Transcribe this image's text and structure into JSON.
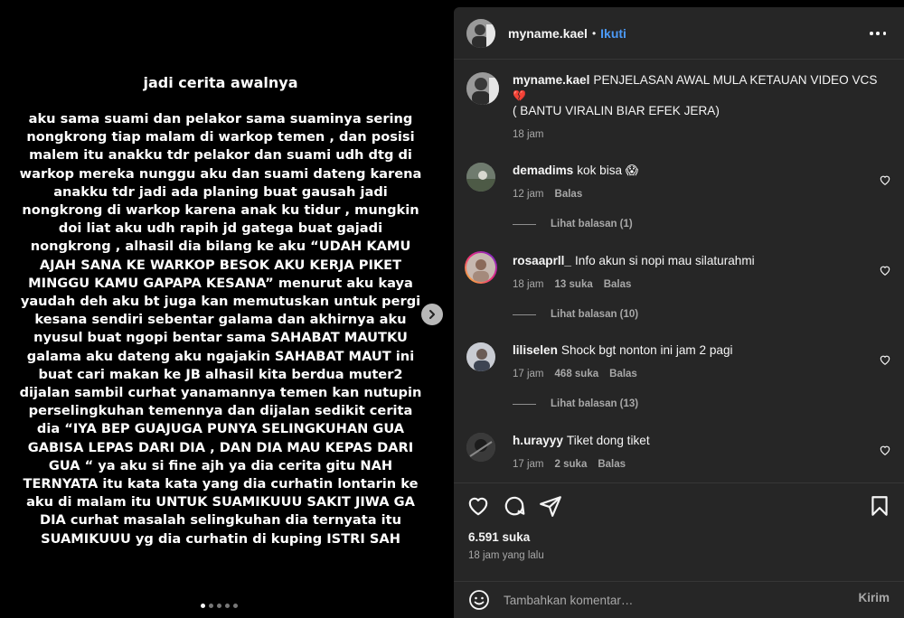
{
  "media": {
    "title": "jadi cerita awalnya",
    "body": "aku sama suami dan pelakor sama suaminya sering\nnongkrong tiap malam di warkop temen , dan posisi\nmalem itu anakku tdr pelakor dan suami udh dtg di\nwarkop mereka nunggu aku dan suami dateng karena\nanakku tdr jadi ada planing buat gausah jadi\nnongkrong di warkop karena anak ku tidur , mungkin\ndoi liat aku udh rapih jd gatega buat gajadi\nnongkrong , alhasil dia bilang ke aku “UDAH KAMU\nAJAH SANA KE WARKOP BESOK AKU KERJA PIKET\nMINGGU KAMU GAPAPA KESANA” menurut aku kaya\nyaudah deh aku bt juga kan memutuskan untuk pergi\nkesana sendiri sebentar galama dan akhirnya aku\nnyusul buat ngopi bentar sama SAHABAT MAUTKU\ngalama aku dateng aku ngajakin SAHABAT MAUT ini\nbuat cari makan ke JB alhasil kita berdua muter2\ndijalan sambil curhat yanamannya temen kan nutupin\nperselingkuhan temennya dan dijalan sedikit cerita\ndia “IYA BEP GUAJUGA PUNYA SELINGKUHAN GUA\nGABISA LEPAS DARI DIA , DAN DIA MAU KEPAS DARI\nGUA “ ya aku si fine ajh ya dia cerita gitu NAH\nTERNYATA itu kata kata yang dia curhatin lontarin ke\naku di malam itu  UNTUK SUAMIKUUU SAKIT JIWA GA\nDIA curhat masalah selingkuhan dia ternyata itu\nSUAMIKUUU yg dia curhatin di kuping ISTRI SAH",
    "slide_count": 5,
    "active_slide": 1
  },
  "header": {
    "username": "myname.kael",
    "separator": "•",
    "follow_label": "Ikuti"
  },
  "caption": {
    "username": "myname.kael",
    "text_line1": "PENJELASAN AWAL MULA KETAUAN VIDEO VCS",
    "emoji": "💔",
    "text_line2": "( BANTU VIRALIN BIAR EFEK JERA)",
    "time": "18 jam"
  },
  "comments": [
    {
      "username": "demadims",
      "text": "kok bisa 😱",
      "time": "12 jam",
      "likes": "",
      "reply_label": "Balas",
      "view_replies": "Lihat balasan (1)"
    },
    {
      "username": "rosaaprll_",
      "text": "Info akun si nopi mau silaturahmi",
      "time": "18 jam",
      "likes": "13 suka",
      "reply_label": "Balas",
      "view_replies": "Lihat balasan (10)"
    },
    {
      "username": "liliselen",
      "text": "Shock bgt nonton ini jam 2 pagi",
      "time": "17 jam",
      "likes": "468 suka",
      "reply_label": "Balas",
      "view_replies": "Lihat balasan (13)"
    },
    {
      "username": "h.urayyy",
      "text": "Tiket dong tiket",
      "time": "17 jam",
      "likes": "2 suka",
      "reply_label": "Balas",
      "view_replies": ""
    }
  ],
  "stats": {
    "likes": "6.591 suka",
    "posted": "18 jam yang lalu"
  },
  "comment_box": {
    "placeholder": "Tambahkan komentar…",
    "send_label": "Kirim"
  },
  "colors": {
    "panel_bg": "#262626",
    "link_blue": "#4c9af7",
    "muted_text": "#a8a8a8"
  }
}
